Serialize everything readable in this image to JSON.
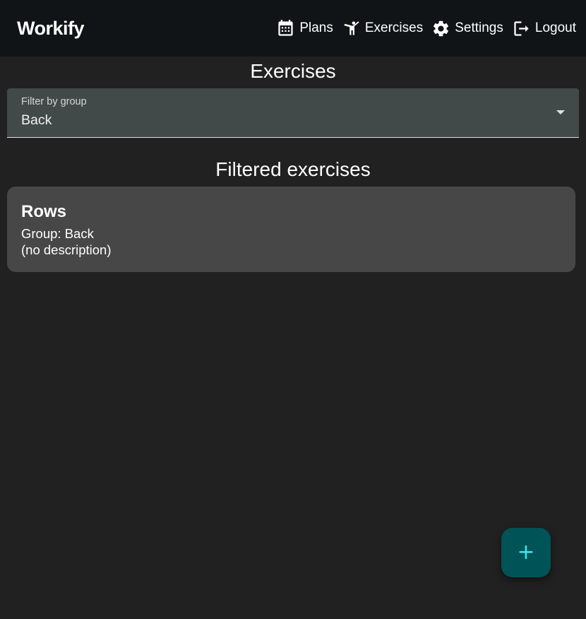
{
  "header": {
    "brand": "Workify",
    "nav": [
      {
        "label": "Plans",
        "icon": "calendar-icon"
      },
      {
        "label": "Exercises",
        "icon": "gymnastics-icon"
      },
      {
        "label": "Settings",
        "icon": "gear-icon"
      },
      {
        "label": "Logout",
        "icon": "logout-icon"
      }
    ]
  },
  "page_title": "Exercises",
  "filter": {
    "label": "Filter by group",
    "value": "Back"
  },
  "section_title": "Filtered exercises",
  "exercises": [
    {
      "name": "Rows",
      "group": "Group: Back",
      "description": "(no description)"
    }
  ],
  "fab": {
    "symbol": "+",
    "icon": "add-icon"
  },
  "colors": {
    "background": "#212121",
    "appbar": "#101416",
    "filter_bg": "#414a48",
    "card_bg": "#474747",
    "fab_bg": "#005356",
    "fab_fg": "#3ee8e8"
  }
}
